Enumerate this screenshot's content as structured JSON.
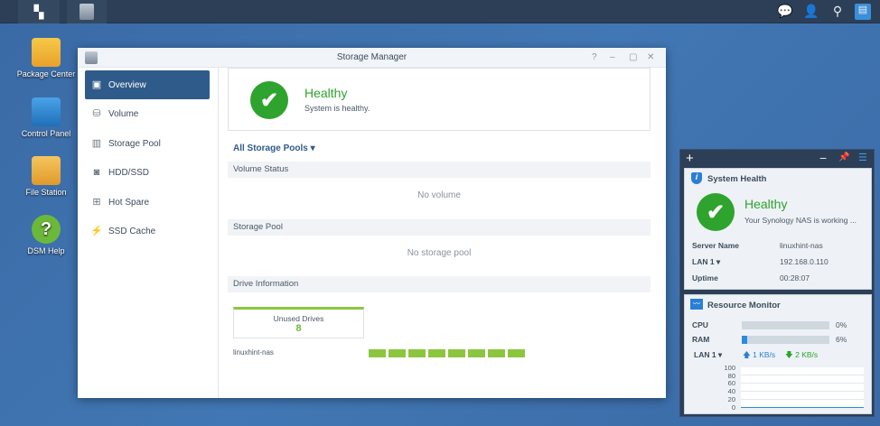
{
  "taskbar": {
    "main_menu_icon": "grid-icon",
    "app_icon": "storage-manager-icon",
    "right_icons": [
      "notification-icon",
      "user-icon",
      "search-icon",
      "widgets-icon"
    ]
  },
  "desktop": [
    {
      "label": "Package Center",
      "icon": "package-center-icon"
    },
    {
      "label": "Control Panel",
      "icon": "control-panel-icon"
    },
    {
      "label": "File Station",
      "icon": "file-station-icon"
    },
    {
      "label": "DSM Help",
      "icon": "help-icon"
    }
  ],
  "window": {
    "title": "Storage Manager",
    "controls": [
      "?",
      "–",
      "▢",
      "✕"
    ],
    "sidebar": [
      {
        "label": "Overview",
        "icon": "overview-icon",
        "active": true
      },
      {
        "label": "Volume",
        "icon": "volume-icon"
      },
      {
        "label": "Storage Pool",
        "icon": "storage-pool-icon"
      },
      {
        "label": "HDD/SSD",
        "icon": "hdd-icon"
      },
      {
        "label": "Hot Spare",
        "icon": "hot-spare-icon"
      },
      {
        "label": "SSD Cache",
        "icon": "ssd-cache-icon"
      }
    ],
    "status": {
      "title": "Healthy",
      "message": "System is healthy."
    },
    "filter": "All Storage Pools",
    "sections": {
      "volume_status": "Volume Status",
      "no_volume": "No volume",
      "storage_pool": "Storage Pool",
      "no_pool": "No storage pool",
      "drive_info": "Drive Information"
    },
    "unused_drives": {
      "label": "Unused Drives",
      "count": "8"
    },
    "nas": {
      "name": "linuxhint-nas",
      "drive_slots": 8,
      "slot_color": "#8cc63f"
    }
  },
  "panel": {
    "health": {
      "title": "System Health",
      "status": "Healthy",
      "message": "Your Synology NAS is working ...",
      "rows": [
        {
          "label": "Server Name",
          "value": "linuxhint-nas"
        },
        {
          "label": "LAN 1 ▾",
          "value": "192.168.0.110"
        },
        {
          "label": "Uptime",
          "value": "00:28:07"
        }
      ]
    },
    "monitor": {
      "title": "Resource Monitor",
      "cpu_label": "CPU",
      "cpu": "0%",
      "cpu_value": 0,
      "ram_label": "RAM",
      "ram": "6%",
      "ram_value": 6,
      "lan_label": "LAN 1 ▾",
      "upload": "1 KB/s",
      "download": "2 KB/s",
      "y_ticks": [
        "100",
        "80",
        "60",
        "40",
        "20",
        "0"
      ]
    }
  },
  "colors": {
    "healthy": "#2ea32e",
    "accent": "#2f5b8a",
    "drive": "#8cc63f"
  }
}
